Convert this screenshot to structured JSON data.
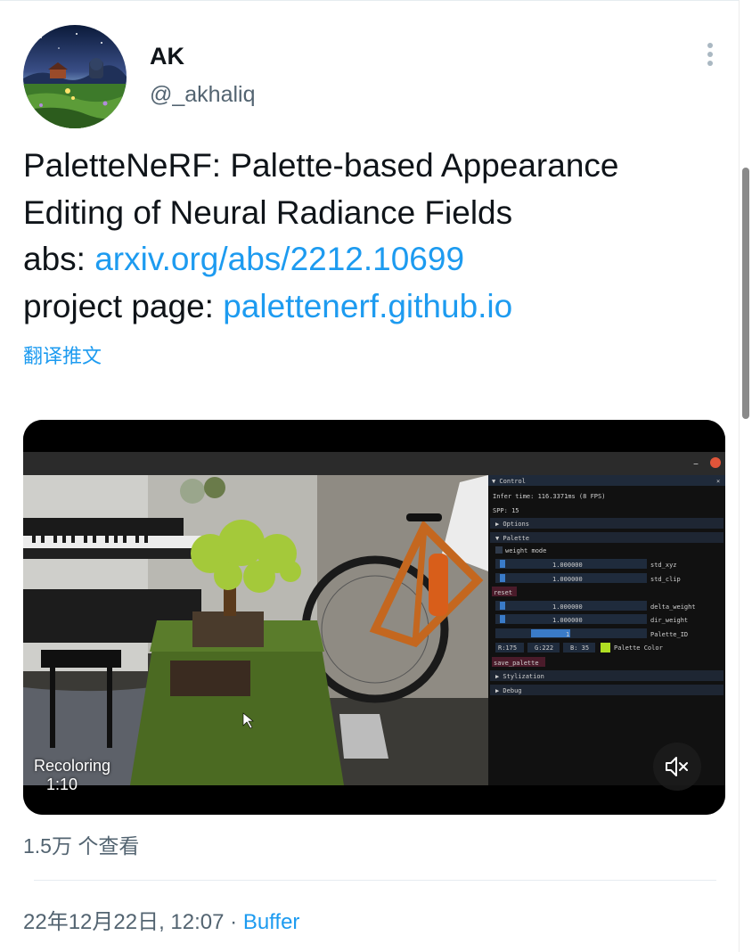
{
  "author": {
    "name": "AK",
    "handle": "@_akhaliq"
  },
  "tweet": {
    "title_line1": "PaletteNeRF: Palette-based Appearance",
    "title_line2": "Editing of Neural Radiance Fields",
    "abs_label": "abs: ",
    "abs_link": "arxiv.org/abs/2212.10699",
    "project_label": "project page: ",
    "project_link": "palettenerf.github.io",
    "translate": "翻译推文"
  },
  "video": {
    "label": "Recoloring",
    "duration": "1:10",
    "panel": {
      "header": "▼ Control",
      "close": "×",
      "minimize": "–",
      "infer_time": "Infer time:  116.3371ms (8 FPS)",
      "spp": "SPP:  15",
      "options": "▶ Options",
      "palette": "▼ Palette",
      "weight_mode": "weight mode",
      "value_std_xyz": "1.000000",
      "label_std_xyz": "std_xyz",
      "value_std_clip": "1.000000",
      "label_std_clip": "std_clip",
      "reset": "reset",
      "value_delta_weight": "1.000000",
      "label_delta_weight": "delta_weight",
      "value_dir_weight": "1.000000",
      "label_dir_weight": "dir_weight",
      "value_palette_id": "1",
      "label_palette_id": "Palette_ID",
      "color_r": "R:175",
      "color_g": "G:222",
      "color_b": "B: 35",
      "palette_color_label": "Palette Color",
      "palette_color_swatch": "#afde23",
      "save_palette": "save_palette",
      "stylization": "▶ Stylization",
      "debug": "▶ Debug"
    }
  },
  "stats": {
    "views": "1.5万 个查看"
  },
  "meta": {
    "date": "22年12月22日, 12:07 · ",
    "source": "Buffer"
  },
  "colors": {
    "link": "#1d9bf0",
    "secondary": "#536471",
    "text": "#0f1419"
  }
}
